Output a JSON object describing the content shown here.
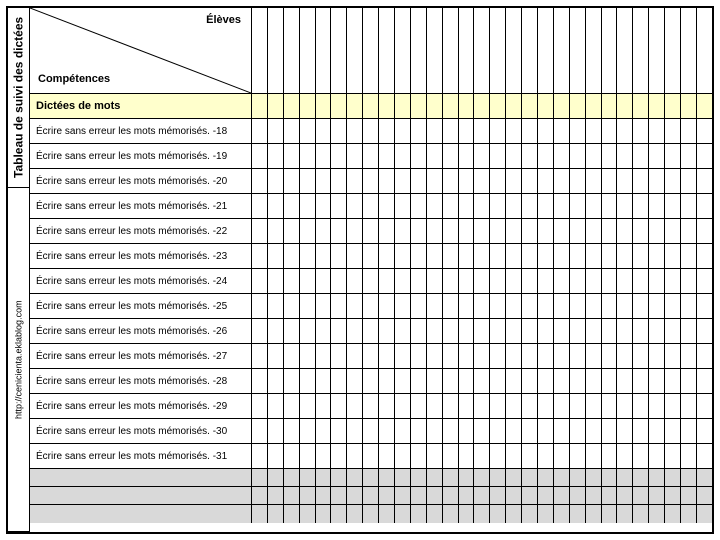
{
  "sidebar": {
    "title": "Tableau de suivi des dictées",
    "url": "http://cenicienta.eklablog.com"
  },
  "header": {
    "students_label": "Élèves",
    "competences_label": "Compétences"
  },
  "section": {
    "title": "Dictées de mots"
  },
  "rows": [
    {
      "label": "Écrire sans erreur les mots mémorisés. -18"
    },
    {
      "label": "Écrire sans erreur les mots mémorisés. -19"
    },
    {
      "label": "Écrire sans erreur les mots mémorisés. -20"
    },
    {
      "label": "Écrire sans erreur les mots mémorisés. -21"
    },
    {
      "label": "Écrire sans erreur les mots mémorisés. -22"
    },
    {
      "label": "Écrire sans erreur les mots mémorisés. -23"
    },
    {
      "label": "Écrire sans erreur les mots mémorisés. -24"
    },
    {
      "label": "Écrire sans erreur les mots mémorisés. -25"
    },
    {
      "label": "Écrire sans erreur les mots mémorisés. -26"
    },
    {
      "label": "Écrire sans erreur les mots mémorisés. -27"
    },
    {
      "label": "Écrire sans erreur les mots mémorisés. -28"
    },
    {
      "label": "Écrire sans erreur les mots mémorisés. -29"
    },
    {
      "label": "Écrire sans erreur les mots mémorisés. -30"
    },
    {
      "label": "Écrire sans erreur les mots mémorisés. -31"
    }
  ],
  "empty_rows": 3,
  "grid_columns": 29
}
